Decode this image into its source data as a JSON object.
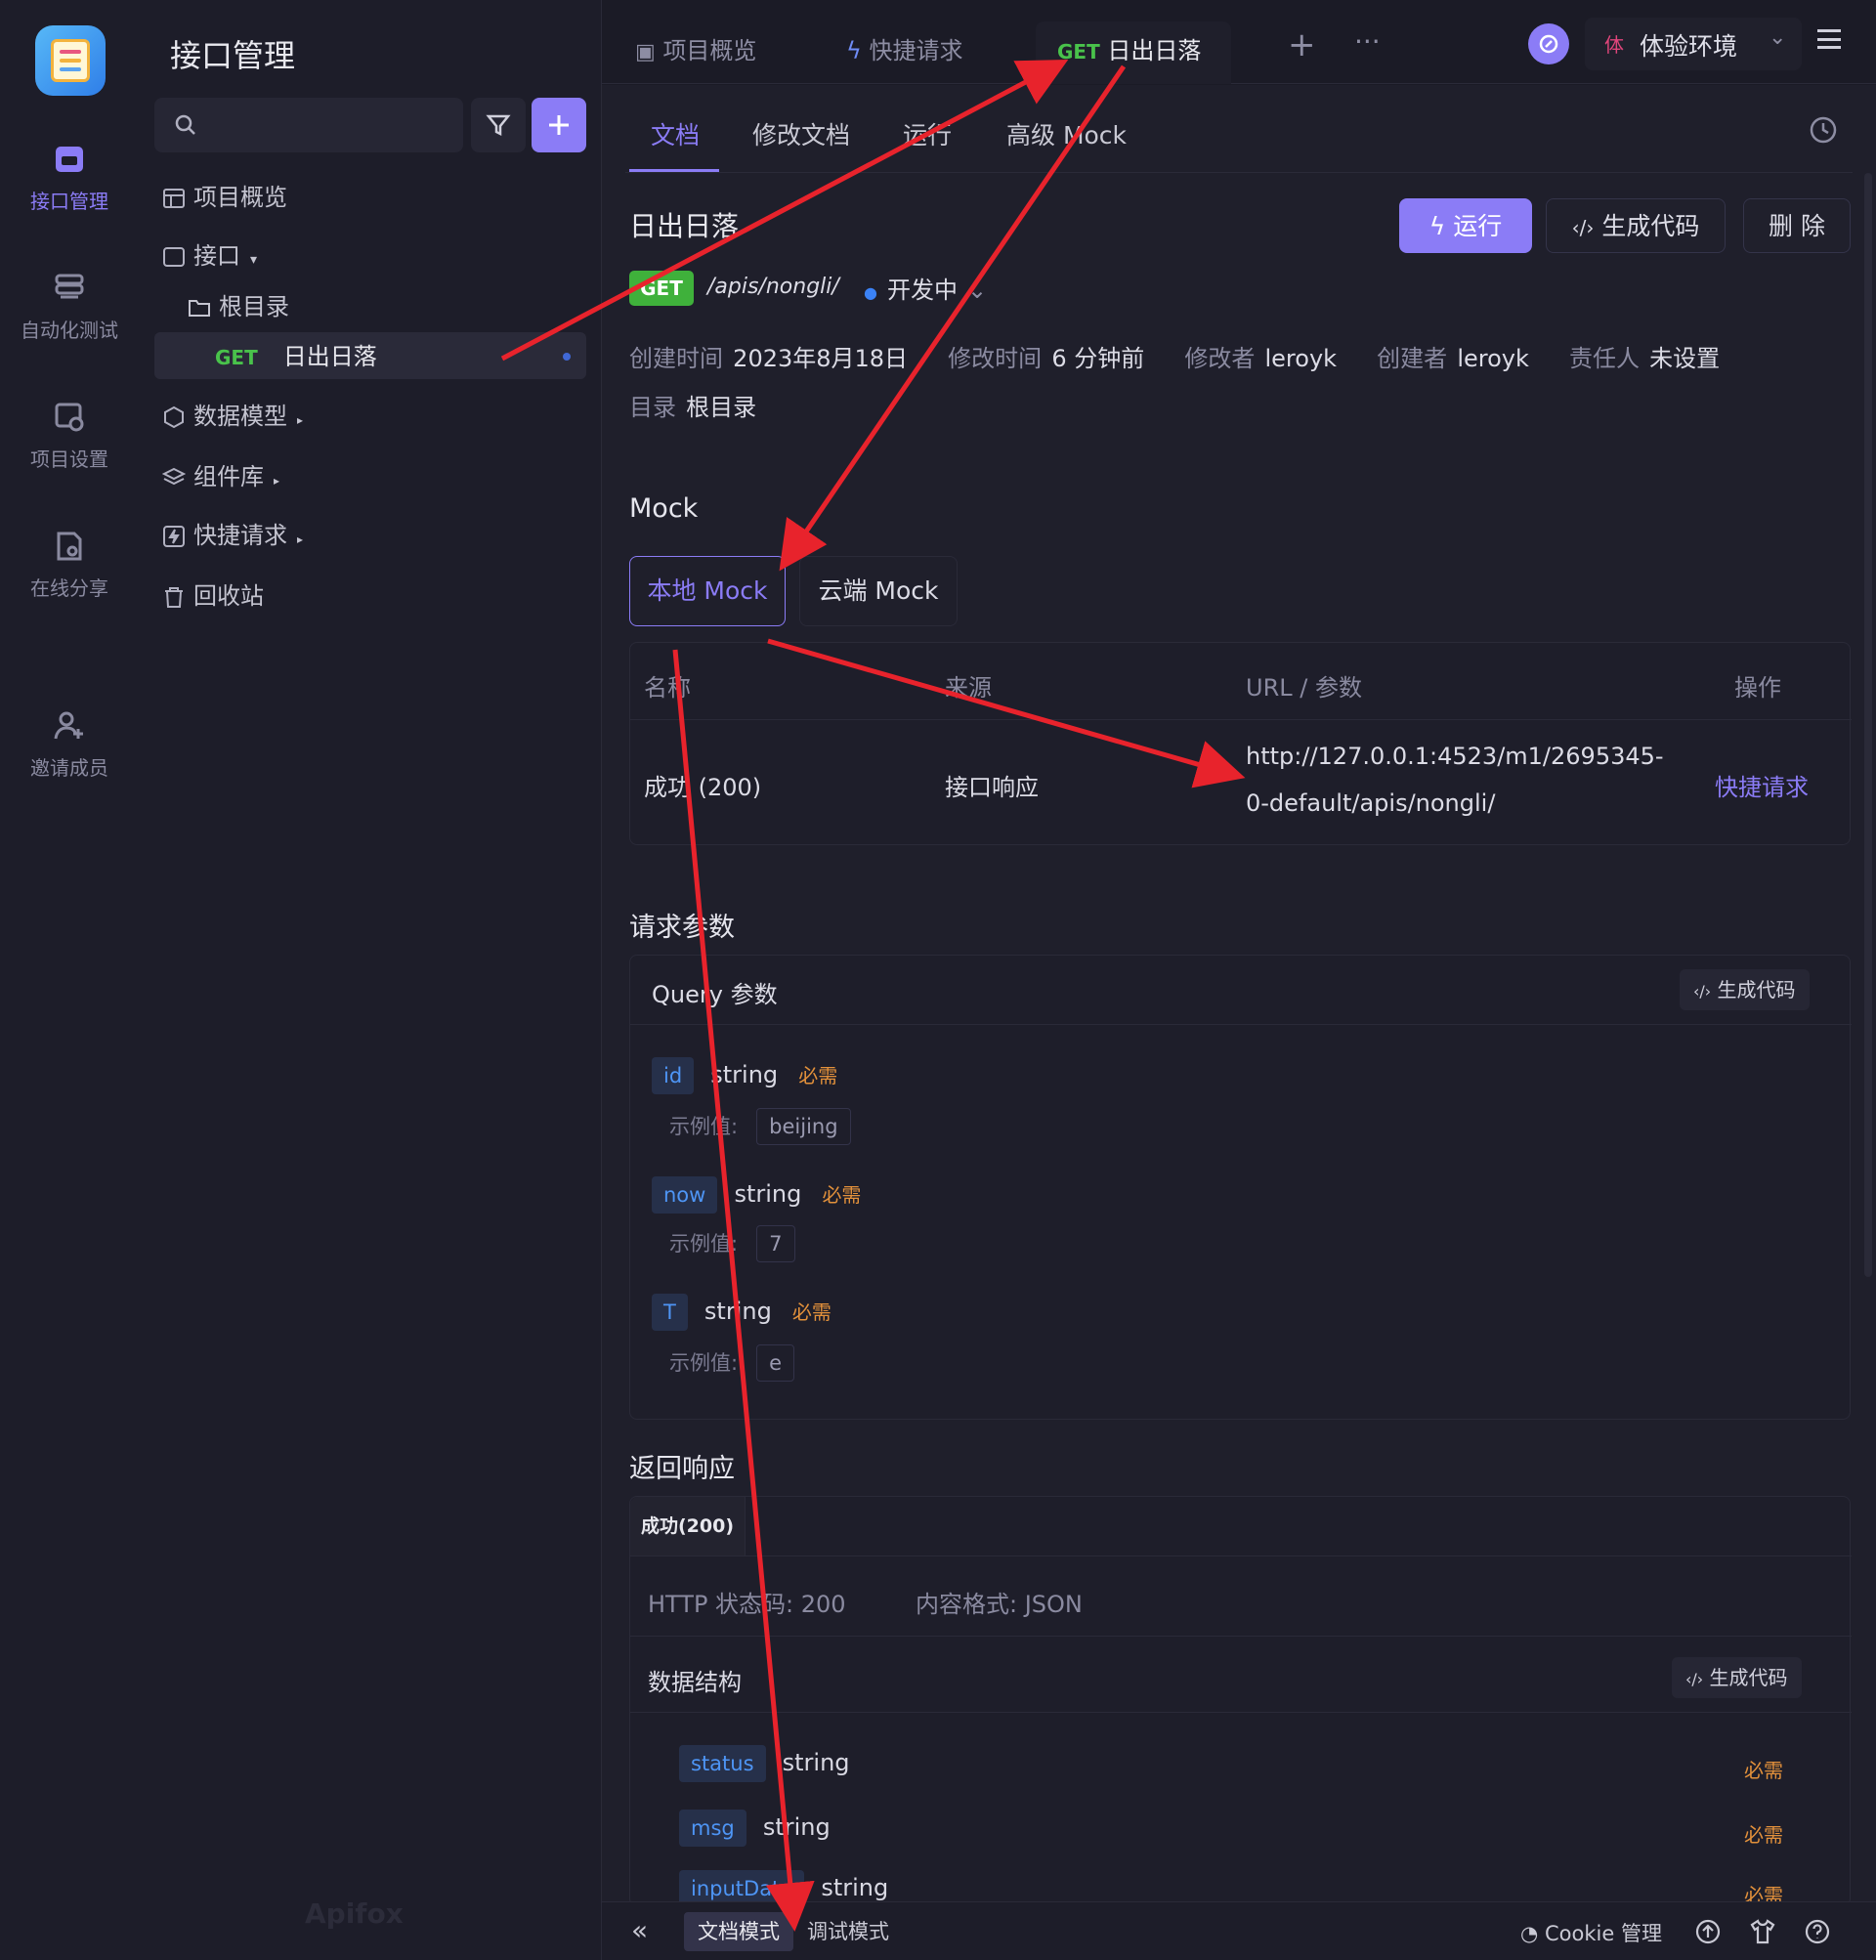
{
  "rail": {
    "items": [
      {
        "label": "接口管理",
        "icon": "api-icon"
      },
      {
        "label": "自动化测试",
        "icon": "automation-icon"
      },
      {
        "label": "项目设置",
        "icon": "project-settings-icon"
      },
      {
        "label": "在线分享",
        "icon": "share-icon"
      },
      {
        "label": "邀请成员",
        "icon": "invite-user-icon"
      }
    ]
  },
  "sidebar": {
    "title": "接口管理",
    "tree": [
      {
        "label": "项目概览"
      },
      {
        "label": "接口"
      },
      {
        "label": "根目录"
      },
      {
        "method": "GET",
        "label": "日出日落"
      },
      {
        "label": "数据模型"
      },
      {
        "label": "组件库"
      },
      {
        "label": "快捷请求"
      },
      {
        "label": "回收站"
      }
    ],
    "watermark": "Apifox"
  },
  "topbar": {
    "tabs": [
      {
        "label": "项目概览"
      },
      {
        "label": "快捷请求"
      },
      {
        "method": "GET",
        "label": "日出日落"
      }
    ],
    "env_badge": "体",
    "env_label": "体验环境"
  },
  "subtabs": [
    "文档",
    "修改文档",
    "运行",
    "高级 Mock"
  ],
  "api": {
    "name": "日出日落",
    "method": "GET",
    "path": "/apis/nongli/",
    "status": "开发中",
    "buttons": {
      "run": "运行",
      "gen_code": "生成代码",
      "delete": "删 除"
    },
    "meta": {
      "created_label": "创建时间",
      "created": "2023年8月18日",
      "modified_label": "修改时间",
      "modified": "6 分钟前",
      "modifier_label": "修改者",
      "modifier": "leroyk",
      "creator_label": "创建者",
      "creator": "leroyk",
      "owner_label": "责任人",
      "owner": "未设置",
      "dir_label": "目录",
      "dir": "根目录"
    }
  },
  "mock": {
    "title": "Mock",
    "tabs": [
      "本地 Mock",
      "云端 Mock"
    ],
    "columns": [
      "名称",
      "来源",
      "URL / 参数",
      "操作"
    ],
    "row": {
      "name": "成功 (200)",
      "source": "接口响应",
      "url_line1": "http://127.0.0.1:4523/m1/2695345-",
      "url_line2": "0-default/apis/nongli/",
      "action": "快捷请求"
    }
  },
  "request": {
    "title": "请求参数",
    "query_title": "Query 参数",
    "gen_code": "生成代码",
    "example_label": "示例值:",
    "params": [
      {
        "name": "id",
        "type": "string",
        "required": "必需",
        "example": "beijing"
      },
      {
        "name": "now",
        "type": "string",
        "required": "必需",
        "example": "7"
      },
      {
        "name": "T",
        "type": "string",
        "required": "必需",
        "example": "e"
      }
    ]
  },
  "response": {
    "title": "返回响应",
    "tab": "成功(200)",
    "http_status": "HTTP 状态码: 200",
    "content_type": "内容格式: JSON",
    "schema_title": "数据结构",
    "gen_code": "生成代码",
    "fields": [
      {
        "name": "status",
        "type": "string",
        "required": "必需"
      },
      {
        "name": "msg",
        "type": "string",
        "required": "必需"
      },
      {
        "name": "inputDate",
        "type": "string",
        "required": "必需"
      }
    ]
  },
  "bottombar": {
    "collapse": "«",
    "doc_mode": "文档模式",
    "debug_mode": "调试模式",
    "cookie": "Cookie 管理"
  },
  "colors": {
    "accent": "#8b7cf6",
    "get": "#49c24b",
    "required": "#e3913b",
    "arrow": "#e8232c"
  }
}
